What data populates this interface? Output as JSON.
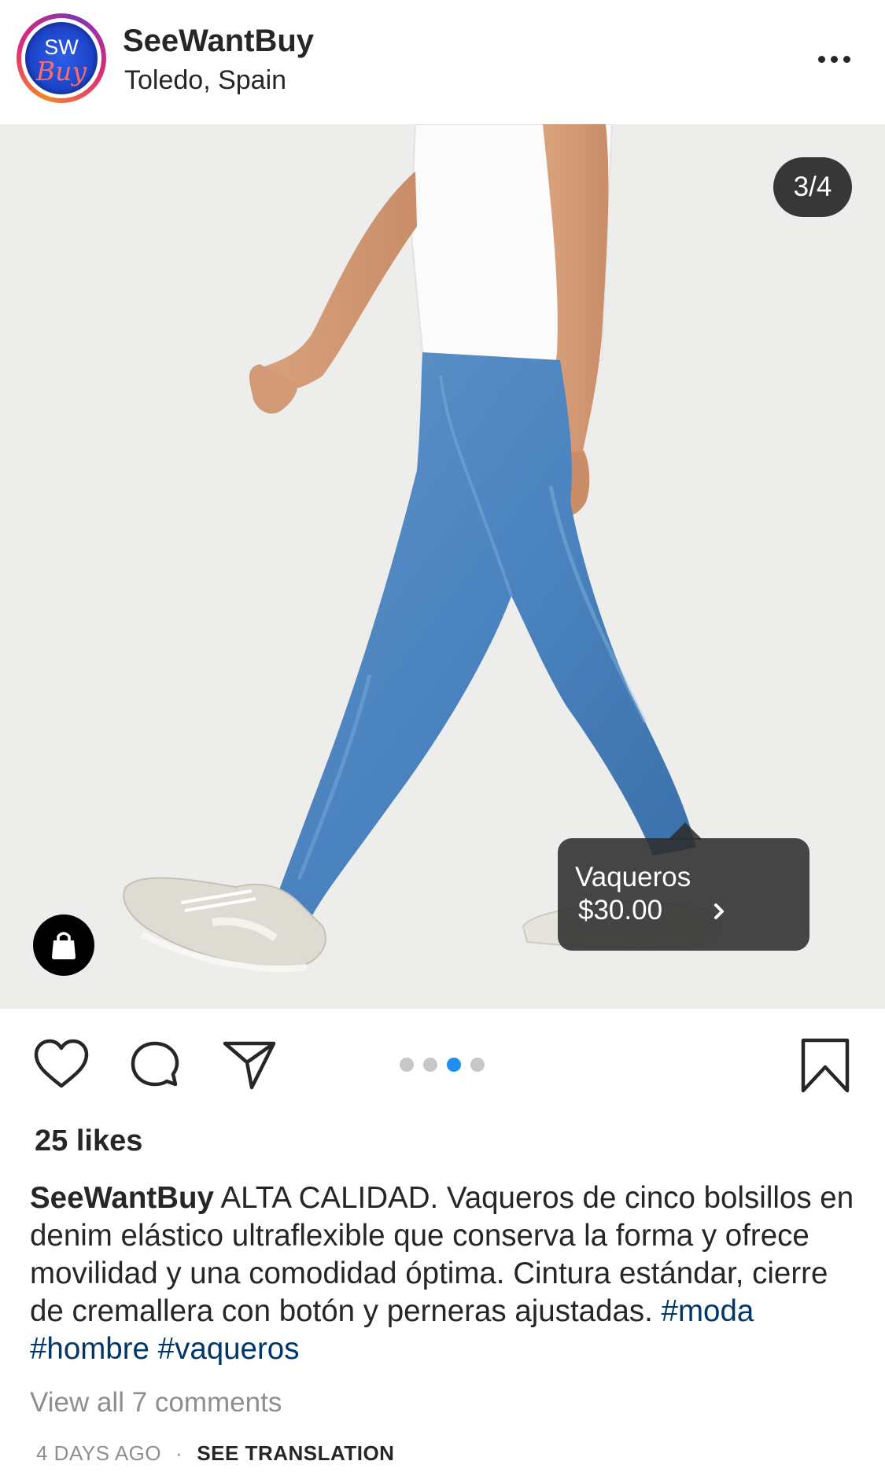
{
  "header": {
    "avatar_text_top": "SW",
    "avatar_text_bottom": "Buy",
    "username": "SeeWantBuy",
    "location": "Toledo, Spain",
    "more_icon": "more-horizontal-icon"
  },
  "photo": {
    "counter": "3/4",
    "shop_icon": "shopping-bag-icon",
    "tag": {
      "name": "Vaqueros",
      "price": "$30.00",
      "chevron_icon": "chevron-right-icon"
    }
  },
  "actions": {
    "like_icon": "heart-icon",
    "comment_icon": "comment-icon",
    "share_icon": "send-icon",
    "save_icon": "bookmark-icon",
    "carousel": {
      "total": 4,
      "active_index": 2
    }
  },
  "post": {
    "likes": "25 likes",
    "caption_user": "SeeWantBuy",
    "caption_text": " ALTA CALIDAD. Vaqueros de cinco bolsillos en denim elástico ultraflexible que conserva la forma y ofrece movilidad y una comodidad óptima. Cintura estándar, cierre de cremallera con botón y perneras ajustadas. ",
    "hashtags": [
      "#moda",
      "#hombre",
      "#vaqueros"
    ],
    "view_comments": "View all 7 comments",
    "time_ago": "4 DAYS AGO",
    "separator": "·",
    "see_translation": "SEE TRANSLATION"
  },
  "colors": {
    "accent_blue": "#1f8ff3",
    "hashtag": "#00376b",
    "muted": "#8e8e8e",
    "text": "#262626"
  }
}
